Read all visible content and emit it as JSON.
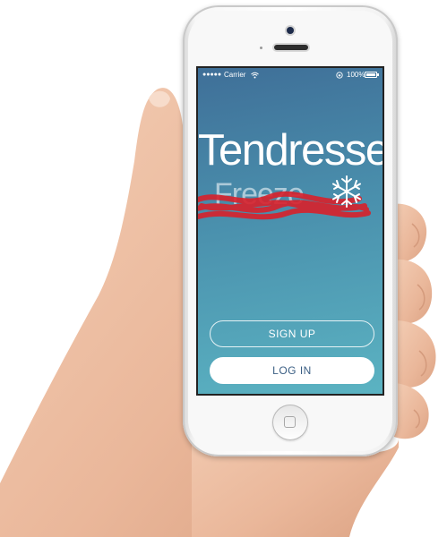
{
  "status_bar": {
    "signal": "●●●●●",
    "carrier": "Carrier",
    "wifi_icon": "wifi-icon",
    "lock_icon": "rotation-lock-icon",
    "battery_percent": "100%"
  },
  "app": {
    "title": "Tendresse",
    "subtitle": "Freeze",
    "logo_icon": "snowflake-icon"
  },
  "buttons": {
    "signup_label": "SIGN UP",
    "login_label": "LOG IN"
  },
  "colors": {
    "screen_top": "#3f6f98",
    "screen_bottom": "#5bb3c2",
    "scribble": "#d8202a",
    "login_text": "#3b5f84"
  }
}
